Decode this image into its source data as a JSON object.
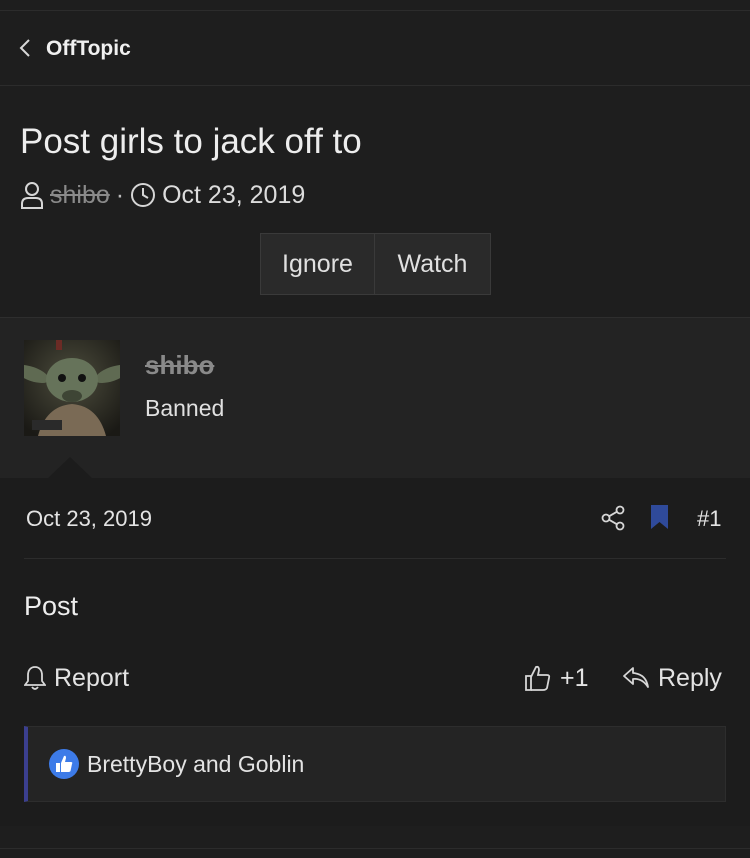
{
  "breadcrumb": {
    "label": "OffTopic",
    "icon": "chevron-left-icon"
  },
  "thread": {
    "title": "Post girls to jack off to",
    "author": "shibo",
    "separator": "·",
    "date": "Oct 23, 2019"
  },
  "actions": {
    "ignore_label": "Ignore",
    "watch_label": "Watch"
  },
  "user": {
    "name": "shibo",
    "title": "Banned"
  },
  "post": {
    "date": "Oct 23, 2019",
    "number": "#1",
    "body": "Post",
    "report_label": "Report",
    "like_count": "+1",
    "reply_label": "Reply",
    "bookmark_color": "#2f4a9a"
  },
  "reactions": {
    "text": "BrettyBoy and Goblin",
    "icon": "thumbs-up-icon",
    "icon_color": "#3d7be8",
    "accent": "#3b3f8f"
  }
}
